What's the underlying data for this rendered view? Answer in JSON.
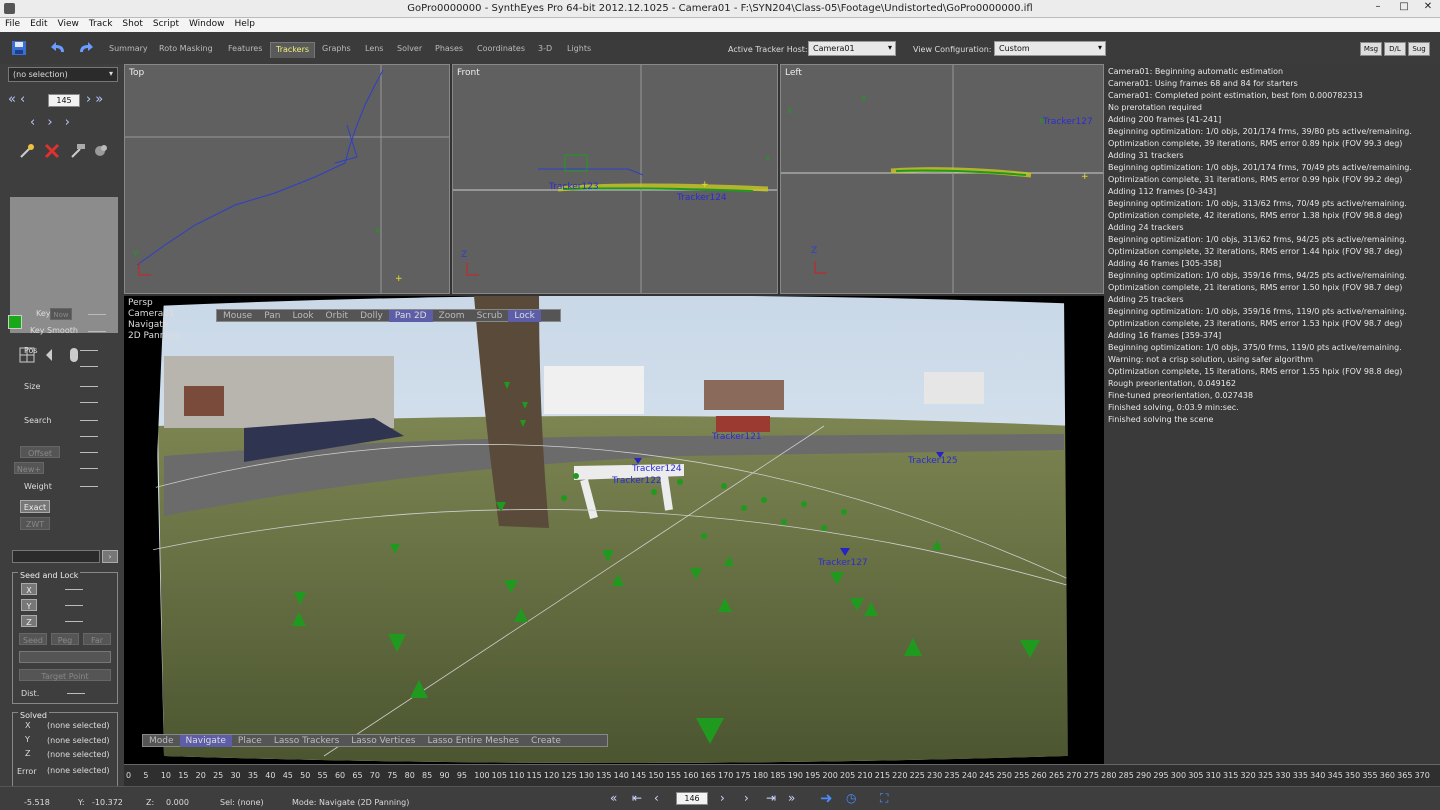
{
  "window": {
    "title": "GoPro0000000 - SynthEyes Pro 64-bit 2012.12.1025 - Camera01 - F:\\SYN204\\Class-05\\Footage\\Undistorted\\GoPro0000000.ifl"
  },
  "menu": [
    "File",
    "Edit",
    "View",
    "Track",
    "Shot",
    "Script",
    "Window",
    "Help"
  ],
  "rooms": [
    "Summary",
    "Roto Masking",
    "Features",
    "Trackers",
    "Graphs",
    "Lens",
    "Solver",
    "Phases",
    "Coordinates",
    "3-D",
    "Lights"
  ],
  "active_room": "Trackers",
  "active_tracker_host": {
    "label": "Active Tracker Host:",
    "value": "Camera01"
  },
  "view_config": {
    "label": "View Configuration:",
    "value": "Custom"
  },
  "corner_buttons": [
    "Msg",
    "D/L",
    "Sug"
  ],
  "left": {
    "selection": "(no selection)",
    "frame": "145",
    "key_label": "Key",
    "key_smooth_label": "Key Smooth",
    "now_label": "Now",
    "pos_label": "Pos",
    "size_label": "Size",
    "search_label": "Search",
    "offset_label": "Offset",
    "new_label": "New+",
    "weight_label": "Weight",
    "exact_label": "Exact",
    "zwt_label": "ZWT",
    "seed_lock_label": "Seed and Lock",
    "x": "X",
    "y": "Y",
    "z": "Z",
    "seed": "Seed",
    "peg": "Peg",
    "far": "Far",
    "target_point": "Target Point",
    "dist": "Dist.",
    "solved_label": "Solved",
    "solved_x": "(none selected)",
    "solved_y": "(none selected)",
    "solved_z": "(none selected)",
    "error_label": "Error",
    "error_val": "(none selected)",
    "solved_row_x": "X",
    "solved_row_y": "Y",
    "solved_row_z": "Z"
  },
  "viewports": {
    "top": "Top",
    "front": "Front",
    "left": "Left"
  },
  "main": {
    "labels": [
      "Persp",
      "Camera01",
      "Navigate",
      "2D Panning"
    ],
    "top_bar": [
      "Mouse",
      "Pan",
      "Look",
      "Orbit",
      "Dolly",
      "Pan 2D",
      "Zoom",
      "Scrub",
      "Lock"
    ],
    "top_bar_active": [
      "Pan 2D",
      "Lock"
    ],
    "bottom_bar": [
      "Mode",
      "Navigate",
      "Place",
      "Lasso Trackers",
      "Lasso Vertices",
      "Lasso Entire Meshes",
      "Create"
    ],
    "bottom_bar_active": [
      "Navigate"
    ],
    "trackers": [
      {
        "name": "Tracker121"
      },
      {
        "name": "Tracker122"
      },
      {
        "name": "Tracker123"
      },
      {
        "name": "Tracker124"
      },
      {
        "name": "Tracker125"
      },
      {
        "name": "Tracker127"
      }
    ]
  },
  "log": [
    "Camera01: Beginning automatic estimation",
    "Camera01: Using frames 68 and 84 for starters",
    "Camera01: Completed point estimation, best fom 0.000782313",
    "No prerotation required",
    "Adding 200 frames [41-241]",
    "Beginning optimization: 1/0 objs, 201/174 frms, 39/80 pts active/remaining.",
    "Optimization complete, 39 iterations, RMS error 0.89 hpix (FOV 99.3 deg)",
    "Adding 31 trackers",
    "Beginning optimization: 1/0 objs, 201/174 frms, 70/49 pts active/remaining.",
    "Optimization complete, 31 iterations, RMS error 0.99 hpix (FOV 99.2 deg)",
    "Adding 112 frames [0-343]",
    "Beginning optimization: 1/0 objs, 313/62 frms, 70/49 pts active/remaining.",
    "Optimization complete, 42 iterations, RMS error 1.38 hpix (FOV 98.8 deg)",
    "Adding 24 trackers",
    "Beginning optimization: 1/0 objs, 313/62 frms, 94/25 pts active/remaining.",
    "Optimization complete, 32 iterations, RMS error 1.44 hpix (FOV 98.7 deg)",
    "Adding 46 frames [305-358]",
    "Beginning optimization: 1/0 objs, 359/16 frms, 94/25 pts active/remaining.",
    "Optimization complete, 21 iterations, RMS error 1.50 hpix (FOV 98.7 deg)",
    "Adding 25 trackers",
    "Beginning optimization: 1/0 objs, 359/16 frms, 119/0 pts active/remaining.",
    "Optimization complete, 23 iterations, RMS error 1.53 hpix (FOV 98.7 deg)",
    "Adding 16 frames [359-374]",
    "Beginning optimization: 1/0 objs, 375/0 frms, 119/0 pts active/remaining.",
    "Warning: not a crisp solution, using safer algorithm",
    "Optimization complete, 15 iterations, RMS error 1.55 hpix (FOV 98.8 deg)",
    "Rough preorientation, 0.049162",
    "Fine-tuned preorientation, 0.027438",
    "Finished solving, 0:03.9 min:sec.",
    "Finished solving the scene"
  ],
  "timeline": {
    "ticks": [
      "0",
      "5",
      "10",
      "15",
      "20",
      "25",
      "30",
      "35",
      "40",
      "45",
      "50",
      "55",
      "60",
      "65",
      "70",
      "75",
      "80",
      "85",
      "90",
      "95",
      "100",
      "105",
      "110",
      "115",
      "120",
      "125",
      "130",
      "135",
      "140",
      "145",
      "150",
      "155",
      "160",
      "165",
      "170",
      "175",
      "180",
      "185",
      "190",
      "195",
      "200",
      "205",
      "210",
      "215",
      "220",
      "225",
      "230",
      "235",
      "240",
      "245",
      "250",
      "255",
      "260",
      "265",
      "270",
      "275",
      "280",
      "285",
      "290",
      "295",
      "300",
      "305",
      "310",
      "315",
      "320",
      "325",
      "330",
      "335",
      "340",
      "345",
      "350",
      "355",
      "360",
      "365",
      "370"
    ]
  },
  "status": {
    "x": "-5.518",
    "y_label": "Y:",
    "y": "-10.372",
    "z_label": "Z:",
    "z": "0.000",
    "sel": "Sel: (none)",
    "mode": "Mode: Navigate (2D Panning)",
    "frame": "146"
  },
  "colors": {
    "tracker_green": "#1f9a1f",
    "tracker_blue": "#2323c8",
    "accent_tab": "#f2f07a"
  }
}
